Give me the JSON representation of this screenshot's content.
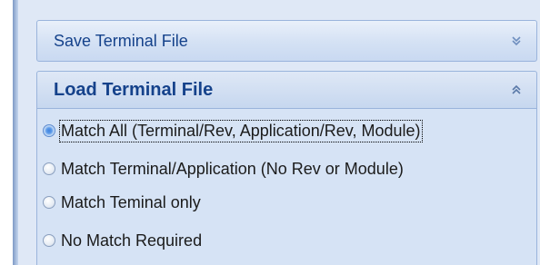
{
  "save_section": {
    "title": "Save Terminal File",
    "icon": "chevron-double-down-icon",
    "expanded": false
  },
  "load_section": {
    "title": "Load Terminal File",
    "icon": "chevron-double-up-icon",
    "expanded": true,
    "options": [
      {
        "label": "Match All (Terminal/Rev, Application/Rev, Module)",
        "checked": true
      },
      {
        "label": "Match Terminal/Application (No Rev or Module)",
        "checked": false
      },
      {
        "label": "Match Teminal only",
        "checked": false
      },
      {
        "label": "No Match Required",
        "checked": false
      }
    ]
  },
  "colors": {
    "panel_bg": "#dfe8f6",
    "header_text": "#15428b",
    "border": "#9ab4dc"
  }
}
